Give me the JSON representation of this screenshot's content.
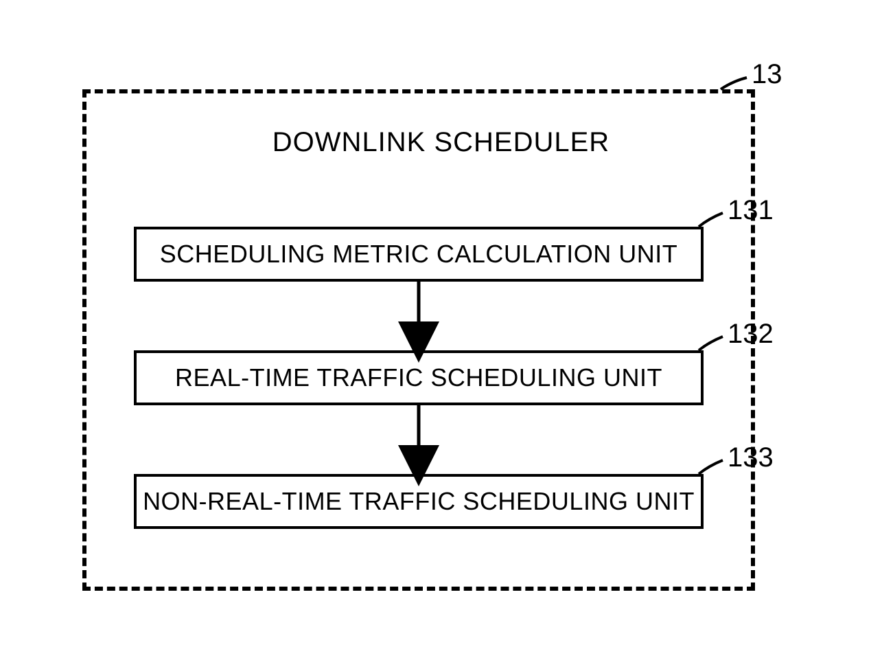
{
  "diagram": {
    "title": "DOWNLINK SCHEDULER",
    "ref_main": "13",
    "blocks": [
      {
        "label": "SCHEDULING METRIC CALCULATION UNIT",
        "ref": "131"
      },
      {
        "label": "REAL-TIME TRAFFIC SCHEDULING UNIT",
        "ref": "132"
      },
      {
        "label": "NON-REAL-TIME TRAFFIC SCHEDULING UNIT",
        "ref": "133"
      }
    ]
  }
}
